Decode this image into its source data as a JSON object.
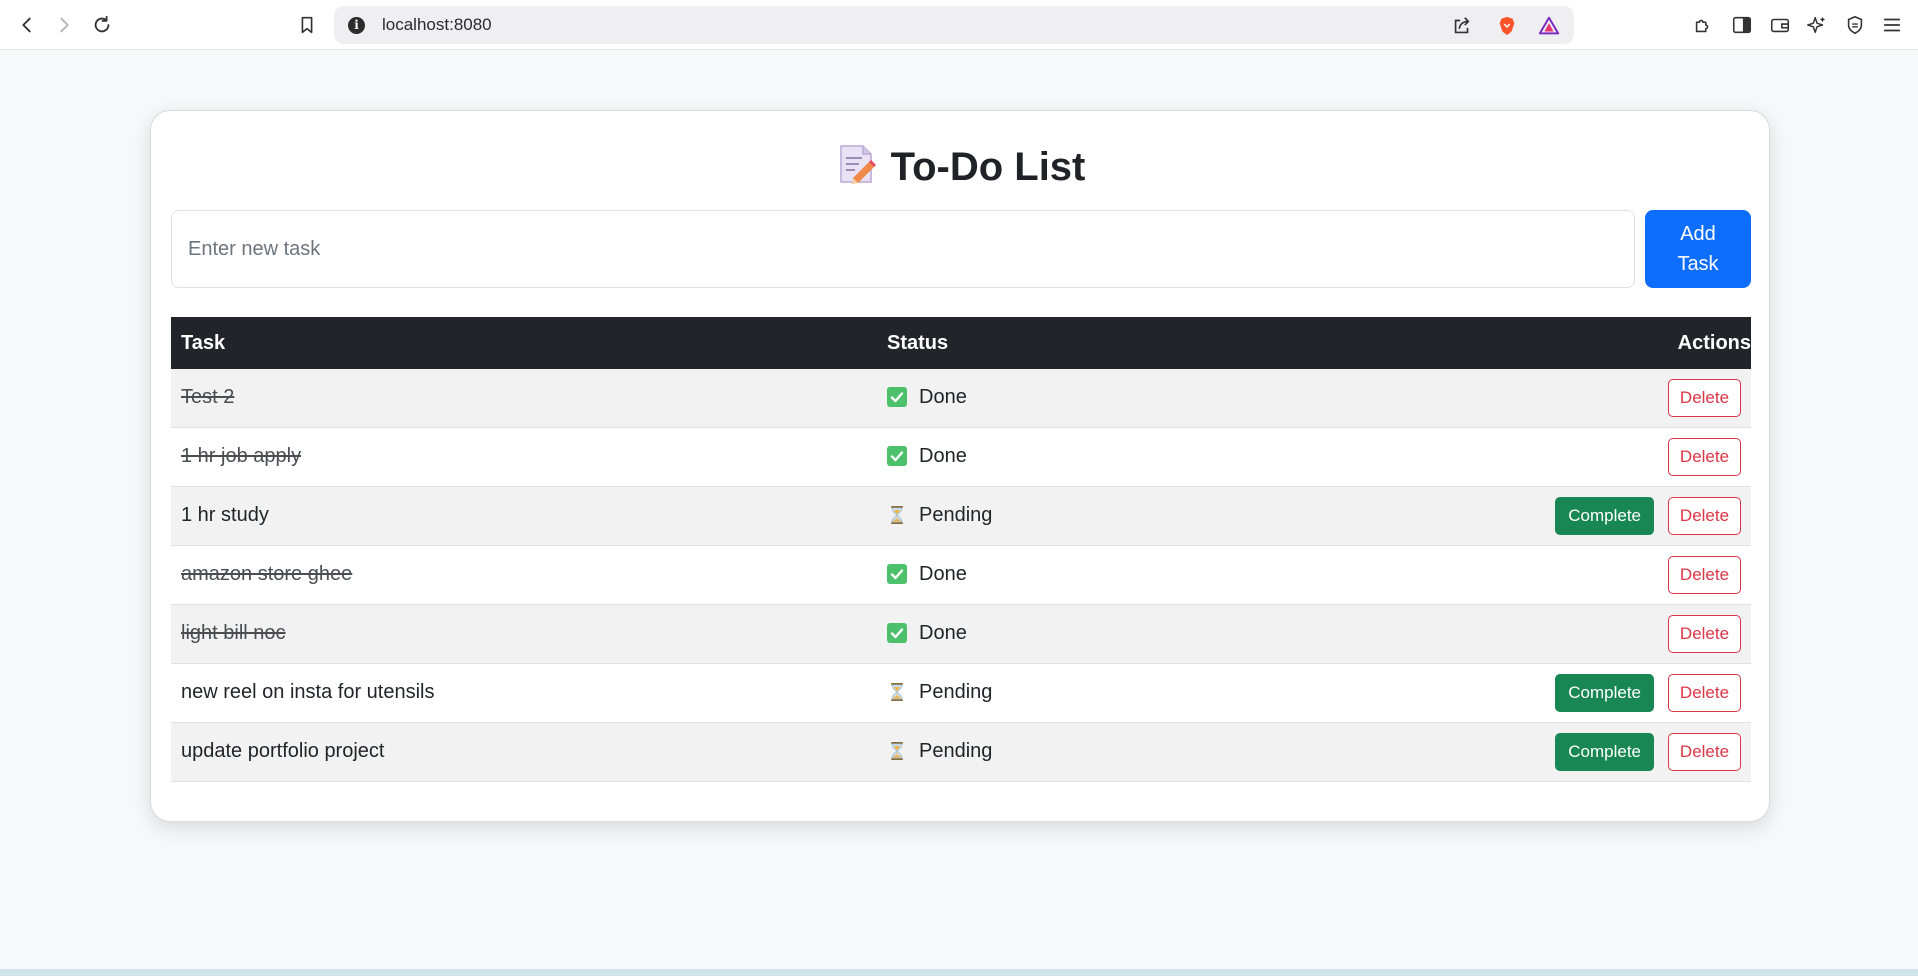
{
  "browser": {
    "url": "localhost:8080"
  },
  "app": {
    "title": "To-Do List",
    "title_icon": "memo-icon",
    "input_placeholder": "Enter new task",
    "input_value": "",
    "add_button_label": "Add Task"
  },
  "table": {
    "headers": {
      "task": "Task",
      "status": "Status",
      "actions": "Actions"
    },
    "complete_label": "Complete",
    "delete_label": "Delete",
    "rows": [
      {
        "task": "Test 2",
        "status": "Done",
        "done": true
      },
      {
        "task": "1 hr job apply",
        "status": "Done",
        "done": true
      },
      {
        "task": "1 hr study",
        "status": "Pending",
        "done": false
      },
      {
        "task": "amazon store ghee",
        "status": "Done",
        "done": true
      },
      {
        "task": "light bill noc",
        "status": "Done",
        "done": true
      },
      {
        "task": "new reel on insta for utensils",
        "status": "Pending",
        "done": false
      },
      {
        "task": "update portfolio project",
        "status": "Pending",
        "done": false
      }
    ]
  },
  "colors": {
    "primary": "#0d6efd",
    "success": "#198754",
    "danger": "#dc3545",
    "header_bg": "#212529"
  }
}
